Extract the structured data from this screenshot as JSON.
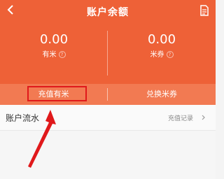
{
  "header": {
    "title": "账户余额",
    "back_icon": "back-arrow-icon",
    "doc_icon": "document-icon",
    "background": "#ee6137"
  },
  "balances": [
    {
      "value": "0.00",
      "label": "有米"
    },
    {
      "value": "0.00",
      "label": "米券"
    }
  ],
  "actions": {
    "recharge_label": "充值有米",
    "exchange_label": "兑换米券"
  },
  "flow": {
    "title": "账户流水",
    "records_link": "充值记录"
  },
  "annotation": {
    "highlight_color": "#e0191b"
  }
}
